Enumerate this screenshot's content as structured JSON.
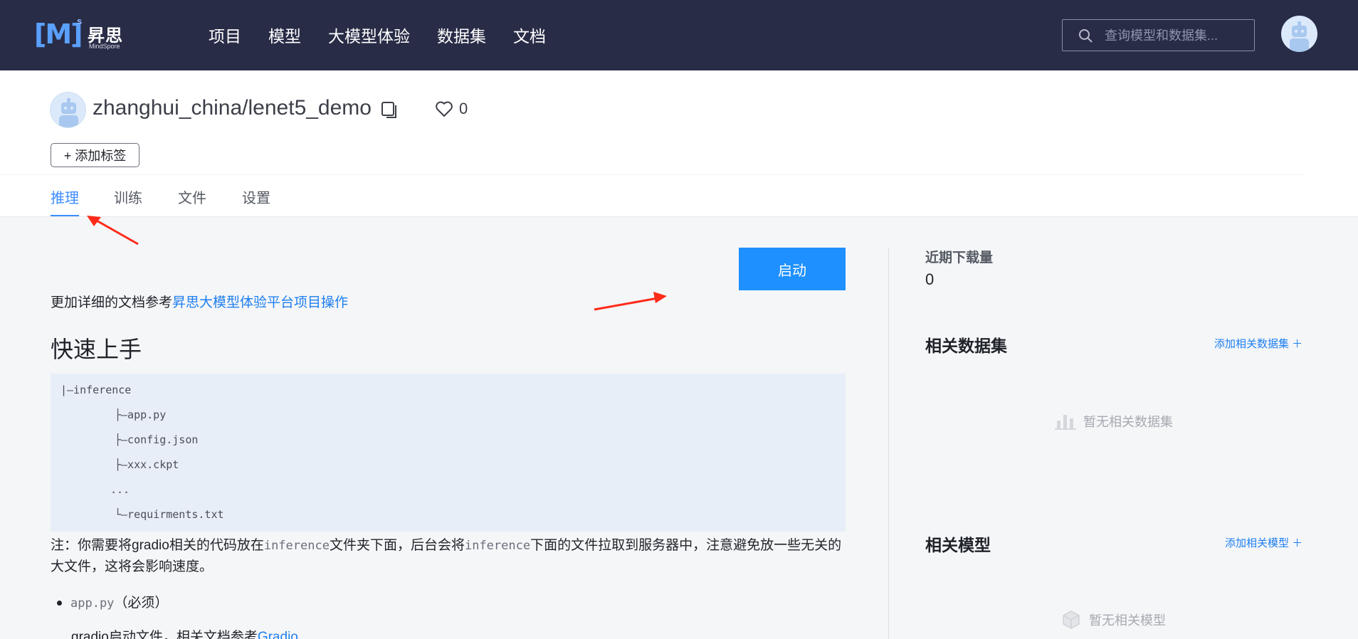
{
  "brand": {
    "logo_mark": "[M]",
    "logo_sup": "s",
    "logo_cn": "昇思",
    "logo_en": "MindSpore"
  },
  "nav": {
    "items": [
      "项目",
      "模型",
      "大模型体验",
      "数据集",
      "文档"
    ],
    "search_placeholder": "查询模型和数据集..."
  },
  "repo": {
    "title": "zhanghui_china/lenet5_demo",
    "likes": "0",
    "add_tag": "+ 添加标签"
  },
  "tabs": [
    "推理",
    "训练",
    "文件",
    "设置"
  ],
  "main": {
    "start_button": "启动",
    "doc_prefix": "更加详细的文档参考",
    "doc_link": "昇思大模型体验平台项目操作",
    "quick_title": "快速上手",
    "code_lines": [
      "|—inference",
      "├—app.py",
      "├—config.json",
      "├—xxx.ckpt",
      "...",
      "└—requirments.txt"
    ],
    "note_1": "注：你需要将gradio相关的代码放在",
    "note_code_1": "inference",
    "note_2": "文件夹下面，后台会将",
    "note_code_2": "inference",
    "note_3": "下面的文件拉取到服务器中，注意避免放一些无关的大文件，这将会影响速度。",
    "bullet_code": "app.py",
    "bullet_text": "（必须）",
    "gradio_text": "gradio启动文件，相关文档参考",
    "gradio_link": "Gradio"
  },
  "sidebar": {
    "downloads_label": "近期下载量",
    "downloads_value": "0",
    "datasets_title": "相关数据集",
    "datasets_add": "添加相关数据集 ＋",
    "datasets_empty": "暂无相关数据集",
    "models_title": "相关模型",
    "models_add": "添加相关模型 ＋",
    "models_empty": "暂无相关模型"
  },
  "colors": {
    "nav_bg": "#282c46",
    "accent": "#1e90ff",
    "link": "#1e7ff0",
    "annotation_arrow": "#ff2a1a"
  }
}
